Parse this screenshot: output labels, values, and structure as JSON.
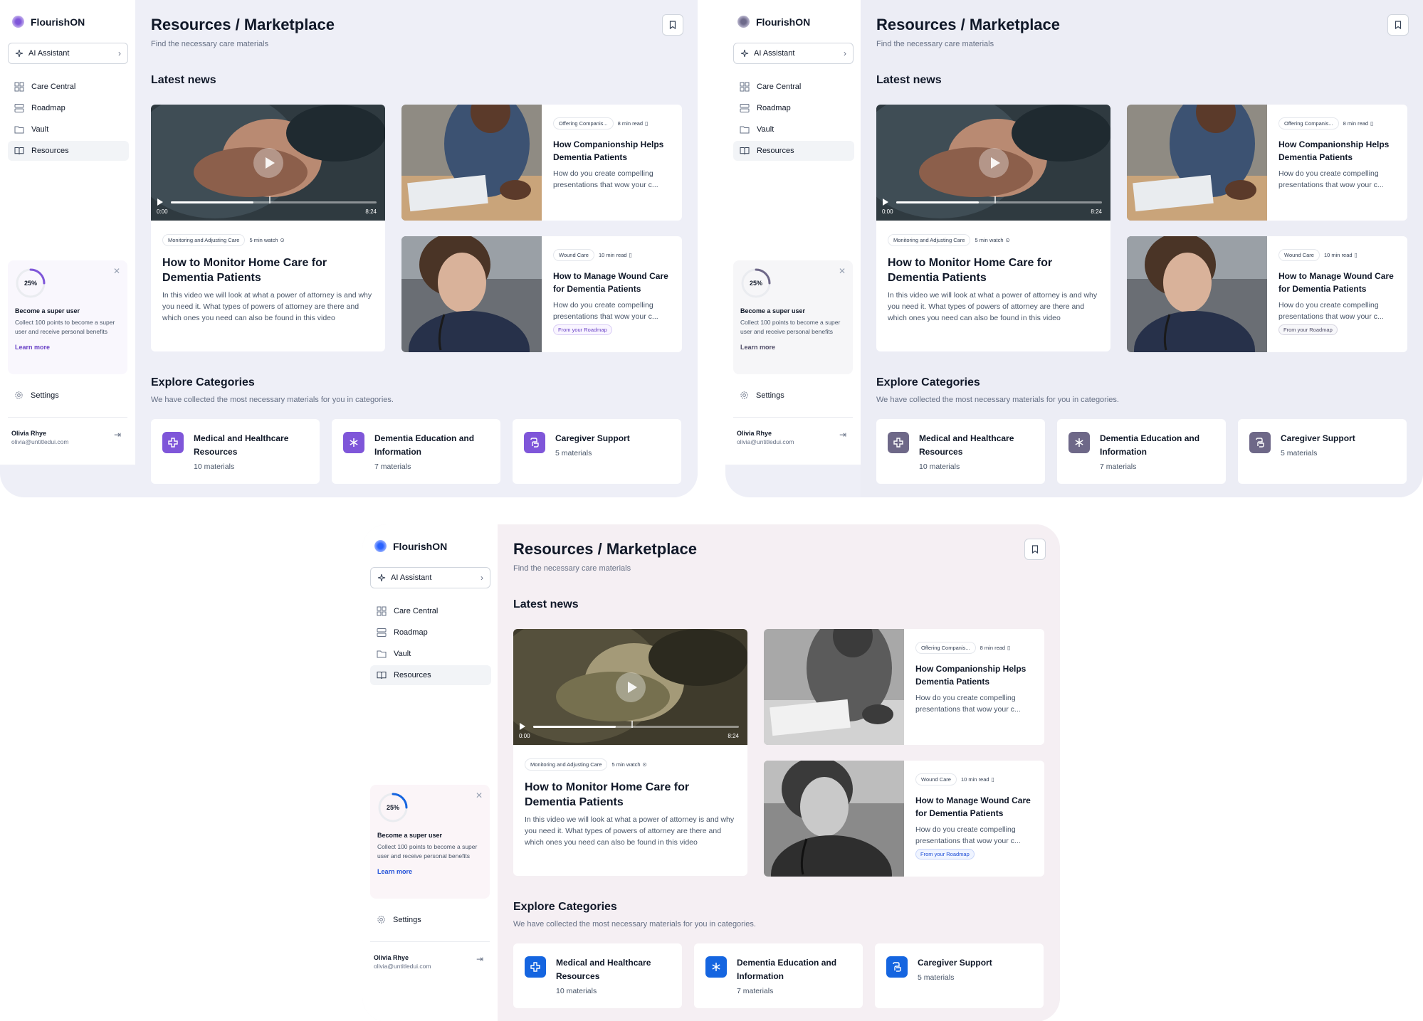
{
  "brand": {
    "name": "FlourishON"
  },
  "sidebar": {
    "ai_button": "AI Assistant",
    "items": [
      {
        "label": "Care Central",
        "icon": "grid-icon",
        "active": false
      },
      {
        "label": "Roadmap",
        "icon": "layers-icon",
        "active": false
      },
      {
        "label": "Vault",
        "icon": "folder-icon",
        "active": false
      },
      {
        "label": "Resources",
        "icon": "book-icon",
        "active": true
      }
    ],
    "promo": {
      "progress_label": "25%",
      "progress": 0.25,
      "title": "Become a super user",
      "text": "Collect 100 points to become a super user and receive personal benefits",
      "link": "Learn more"
    },
    "settings": "Settings",
    "user": {
      "name": "Olivia Rhye",
      "email": "olivia@untitledui.com"
    }
  },
  "header": {
    "title": "Resources / Marketplace",
    "subtitle": "Find the necessary care materials"
  },
  "latest_news": {
    "title": "Latest news",
    "feature": {
      "tag": "Monitoring and Adjusting Care",
      "duration": "5 min watch",
      "title": "How to Monitor Home Care for Dementia Patients",
      "description": "In this video we will look at what a power of attorney is and why you need it. What types of powers of attorney are there and which ones you need can also be found in this video",
      "time_start": "0:00",
      "time_end": "8:24",
      "progress": 0.4
    },
    "cards": [
      {
        "tag": "Offering Companis...",
        "duration": "8 min read",
        "title": "How Companionship Helps Dementia Patients",
        "desc_line1": "How do you create compelling",
        "desc_line2": "presentations that wow your c...",
        "roadmap": ""
      },
      {
        "tag": "Wound Care",
        "duration": "10 min read",
        "title": "How to Manage Wound Care for Dementia Patients",
        "desc_line1": "How do you create compelling",
        "desc_line2": "presentations that wow your c...",
        "roadmap": "From your Roadmap"
      }
    ]
  },
  "categories": {
    "title": "Explore Categories",
    "subtitle": "We have collected the most necessary materials for you in categories.",
    "items": [
      {
        "title": "Medical and Healthcare Resources",
        "count": "10 materials",
        "icon": "medical-cross-icon"
      },
      {
        "title": "Dementia Education and Information",
        "count": "7 materials",
        "icon": "asterisk-icon"
      },
      {
        "title": "Caregiver Support",
        "count": "5 materials",
        "icon": "hands-icon"
      }
    ]
  },
  "themes": {
    "purple": {
      "accent": "#7f56d9",
      "background": "#eeeff7"
    },
    "gray": {
      "accent": "#6e6888",
      "background": "#ecedf5"
    },
    "pink": {
      "accent": "#1565e0",
      "background": "#f5eff3"
    }
  }
}
